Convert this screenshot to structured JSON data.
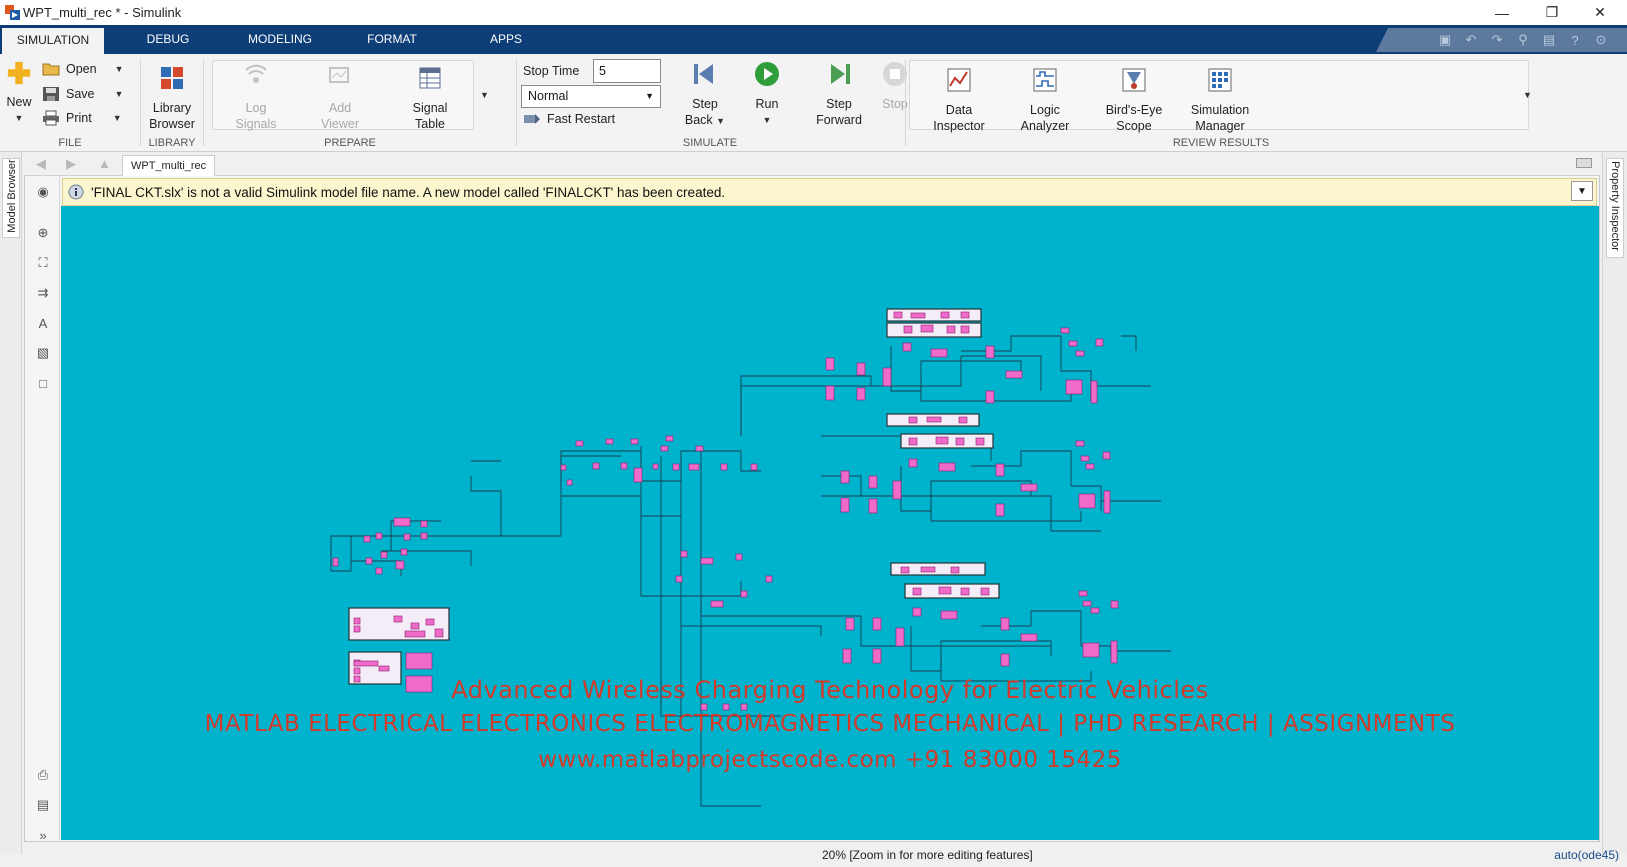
{
  "window": {
    "title": "WPT_multi_rec * - Simulink",
    "minimize": "—",
    "restore": "❐",
    "close": "✕"
  },
  "ribbon_tabs": [
    "SIMULATION",
    "DEBUG",
    "MODELING",
    "FORMAT",
    "APPS"
  ],
  "toolstrip": {
    "file": {
      "label": "FILE",
      "new": "New",
      "open": "Open",
      "save": "Save",
      "print": "Print"
    },
    "library": {
      "label": "LIBRARY",
      "browser_line1": "Library",
      "browser_line2": "Browser"
    },
    "prepare": {
      "label": "PREPARE",
      "log_signals_1": "Log",
      "log_signals_2": "Signals",
      "add_viewer_1": "Add",
      "add_viewer_2": "Viewer",
      "signal_table_1": "Signal",
      "signal_table_2": "Table"
    },
    "simulate": {
      "label": "SIMULATE",
      "stop_time_label": "Stop Time",
      "stop_time_value": "5",
      "mode_value": "Normal",
      "fast_restart": "Fast Restart",
      "step_back_1": "Step",
      "step_back_2": "Back",
      "run": "Run",
      "step_forward_1": "Step",
      "step_forward_2": "Forward",
      "stop": "Stop"
    },
    "review": {
      "label": "REVIEW RESULTS",
      "data_inspector_1": "Data",
      "data_inspector_2": "Inspector",
      "logic_analyzer_1": "Logic",
      "logic_analyzer_2": "Analyzer",
      "birds_eye_1": "Bird's-Eye",
      "birds_eye_2": "Scope",
      "sim_manager_1": "Simulation",
      "sim_manager_2": "Manager"
    }
  },
  "side_tabs": {
    "left": "Model Browser",
    "right": "Property Inspector"
  },
  "editor": {
    "model_tab": "WPT_multi_rec",
    "banner": "'FINAL CKT.slx' is not a valid Simulink model file name. A new model called 'FINALCKT' has been created."
  },
  "watermark": {
    "line1": "Advanced Wireless Charging Technology for Electric Vehicles",
    "line2": "MATLAB ELECTRICAL ELECTRONICS ELECTROMAGNETICS MECHANICAL | PHD RESEARCH | ASSIGNMENTS",
    "line3": "www.matlabprojectscode.com +91 83000 15425"
  },
  "status": {
    "zoom": "20% [Zoom in for more editing features]",
    "solver": "auto(ode45)"
  },
  "colors": {
    "ribbon_blue": "#0d3e78",
    "canvas": "#00b3cc",
    "block": "#f06bc9",
    "watermark": "#d33a2a",
    "banner": "#fbf6cd"
  }
}
